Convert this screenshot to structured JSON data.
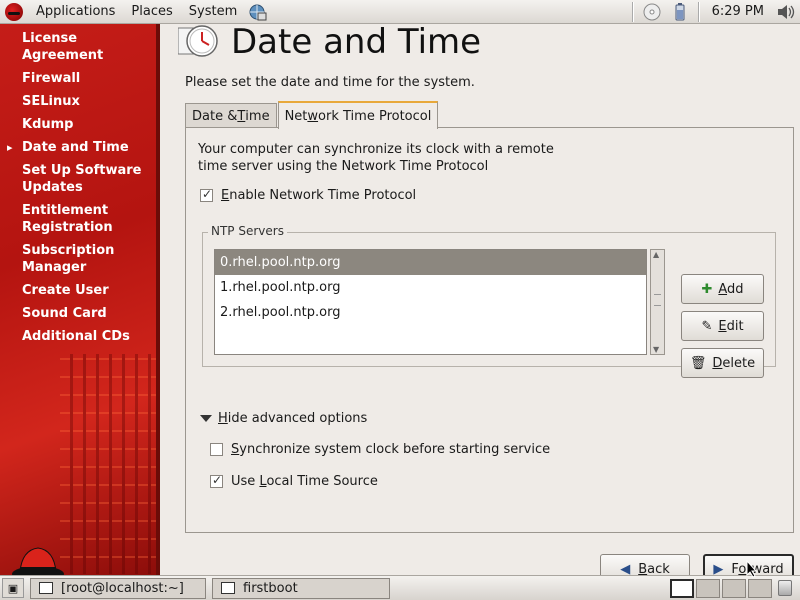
{
  "top_panel": {
    "menus": [
      "Applications",
      "Places",
      "System"
    ],
    "clock": "6:29 PM",
    "icons": [
      "redhat-icon",
      "network-icon",
      "cd-icon",
      "battery-icon",
      "volume-icon"
    ]
  },
  "sidebar": {
    "items": [
      {
        "label": "License Agreement",
        "active": false
      },
      {
        "label": "Firewall",
        "active": false
      },
      {
        "label": "SELinux",
        "active": false
      },
      {
        "label": "Kdump",
        "active": false
      },
      {
        "label": "Date and Time",
        "active": true
      },
      {
        "label": "Set Up Software Updates",
        "active": false
      },
      {
        "label": "Entitlement Registration",
        "active": false
      },
      {
        "label": "Subscription Manager",
        "active": false
      },
      {
        "label": "Create User",
        "active": false
      },
      {
        "label": "Sound Card",
        "active": false
      },
      {
        "label": "Additional CDs",
        "active": false
      }
    ]
  },
  "main": {
    "title": "Date and Time",
    "intro": "Please set the date and time for the system.",
    "tabs": [
      {
        "label_pre": "Date & ",
        "label_u": "T",
        "label_post": "ime",
        "active": false
      },
      {
        "label_pre": "Net",
        "label_u": "w",
        "label_post": "ork Time Protocol",
        "active": true
      }
    ],
    "ntp_description": "Your computer can synchronize its clock with a remote time server using the Network Time Protocol",
    "enable_ntp": {
      "u": "E",
      "rest": "nable Network Time Protocol",
      "checked": true
    },
    "servers_label": "NTP Servers",
    "servers": [
      "0.rhel.pool.ntp.org",
      "1.rhel.pool.ntp.org",
      "2.rhel.pool.ntp.org"
    ],
    "selected_server_index": 0,
    "buttons": {
      "add": {
        "u": "A",
        "rest": "dd"
      },
      "edit": {
        "u": "E",
        "rest": "dit"
      },
      "delete": {
        "u": "D",
        "rest": "elete"
      }
    },
    "advanced_toggle": {
      "u": "H",
      "rest": "ide advanced options"
    },
    "sync_option": {
      "u": "S",
      "rest": "ynchronize system clock before starting service",
      "checked": false
    },
    "local_source": {
      "pre": "Use ",
      "u": "L",
      "rest": "ocal Time Source",
      "checked": true
    }
  },
  "nav": {
    "back": {
      "u": "B",
      "rest": "ack"
    },
    "forward": {
      "pre": "F",
      "u": "o",
      "rest": "rward"
    }
  },
  "taskbar": {
    "tasks": [
      "[root@localhost:~]",
      "firstboot"
    ],
    "workspaces": 4,
    "active_workspace": 0
  }
}
